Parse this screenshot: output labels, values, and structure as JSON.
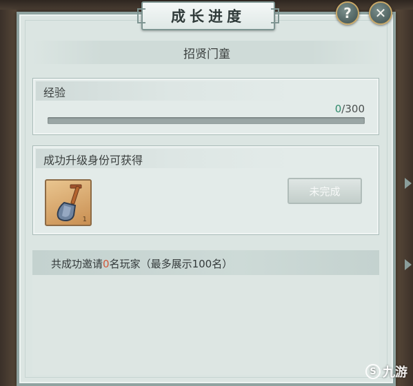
{
  "window": {
    "title": "成长进度"
  },
  "buttons": {
    "help_icon": "?",
    "close_icon": "✕"
  },
  "icons": {
    "help": "help-icon",
    "close": "close-icon",
    "shovel": "shovel-icon"
  },
  "identity": {
    "name": "招贤门童"
  },
  "experience": {
    "label": "经验",
    "current": "0",
    "separator": "/",
    "max": "300",
    "progress": 0.0
  },
  "reward": {
    "label": "成功升级身份可获得",
    "item": {
      "name": "shovel",
      "count": "1"
    },
    "status_label": "未完成"
  },
  "invite": {
    "prefix": "共成功邀请",
    "count": "0",
    "suffix": "名玩家（最多展示100名）"
  },
  "watermark": {
    "logo": "S",
    "text": "九游"
  },
  "colors": {
    "accent_green": "#3aa07a",
    "highlight_count": "#d0573a",
    "panel_bg": "#dbe5e2"
  }
}
